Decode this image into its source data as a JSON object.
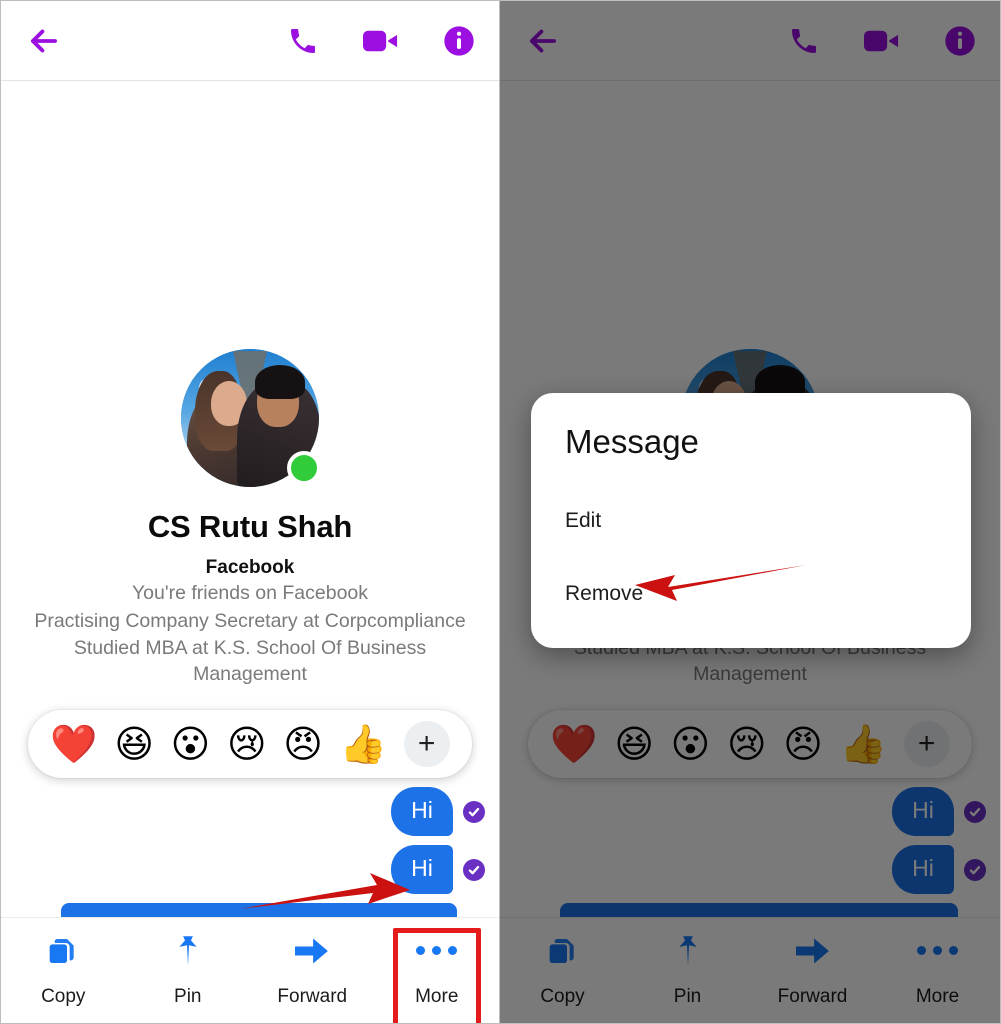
{
  "accent": {
    "purple": "#9b0fe0",
    "purple_dim": "#5d1683",
    "blue": "#1877f2",
    "bubble_blue": "#1d72e8",
    "red": "#e51b1b",
    "online_green": "#31cc3a",
    "tick_purple": "#6a30c4"
  },
  "header": {
    "back_label": "Back",
    "actions": [
      {
        "name": "audio-call",
        "icon": "phone-icon"
      },
      {
        "name": "video-call",
        "icon": "video-camera-icon"
      },
      {
        "name": "conversation-info",
        "icon": "info-icon"
      }
    ]
  },
  "profile": {
    "name": "CS Rutu Shah",
    "source": "Facebook",
    "status_line": "You're friends on Facebook",
    "work_line": "Practising Company Secretary at Corpcompliance",
    "education_line": "Studied MBA at K.S. School Of Business Management",
    "online": true,
    "avatar_alt": "couple-photo-avatar"
  },
  "reactions": {
    "items": [
      {
        "name": "heart-reaction",
        "glyph": "❤️"
      },
      {
        "name": "laugh-reaction",
        "glyph": "😆"
      },
      {
        "name": "wow-reaction",
        "glyph": "😮"
      },
      {
        "name": "sad-reaction",
        "glyph": "😢"
      },
      {
        "name": "angry-reaction",
        "glyph": "😠"
      },
      {
        "name": "like-reaction",
        "glyph": "👍"
      }
    ],
    "add_label": "+"
  },
  "messages": [
    {
      "text": "Hi",
      "sent": true,
      "delivered": true
    },
    {
      "text": "Hi",
      "sent": true,
      "delivered": true
    }
  ],
  "toolbar": {
    "items": [
      {
        "label": "Copy",
        "icon": "copy-icon",
        "highlighted": false
      },
      {
        "label": "Pin",
        "icon": "pin-icon",
        "highlighted": false
      },
      {
        "label": "Forward",
        "icon": "forward-arrow-icon",
        "highlighted": false
      },
      {
        "label": "More",
        "icon": "more-dots-icon",
        "highlighted": true
      }
    ]
  },
  "dialog": {
    "title": "Message",
    "options": [
      {
        "label": "Edit"
      },
      {
        "label": "Remove"
      }
    ]
  },
  "annotations": [
    {
      "name": "arrow-to-message-bubble",
      "panel": "left",
      "direction": "right",
      "color": "#cc1111"
    },
    {
      "name": "arrow-to-remove-option",
      "panel": "right",
      "direction": "left",
      "color": "#cc1111"
    }
  ]
}
